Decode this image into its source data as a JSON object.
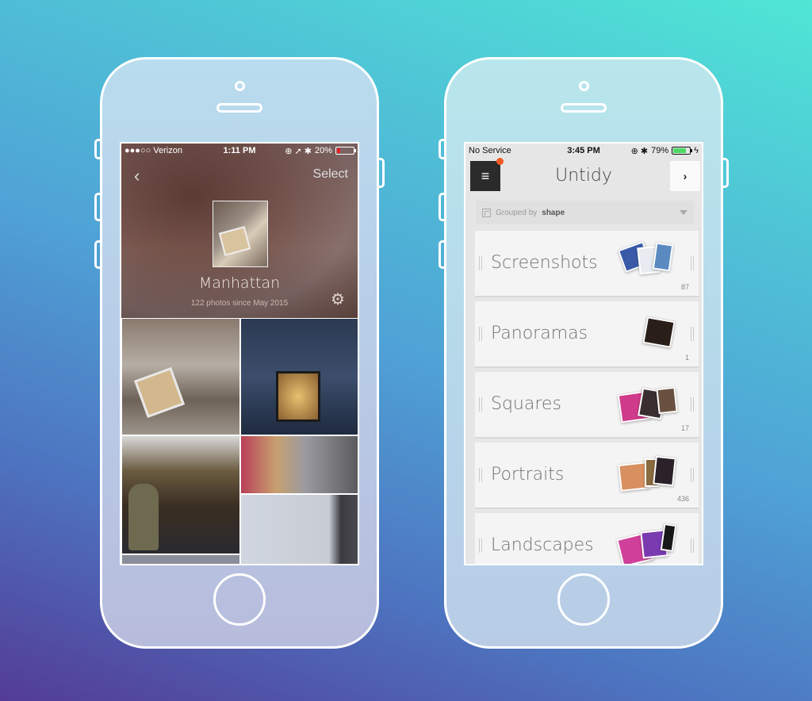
{
  "left_phone": {
    "status": {
      "carrier": "●●●○○ Verizon",
      "wifi_icon": "wifi-icon",
      "time": "1:11 PM",
      "icons": "⊕ ➚ ✱",
      "battery": "20%",
      "battery_level": 0.2,
      "battery_color": "#e8202a"
    },
    "nav": {
      "back": "‹",
      "select": "Select"
    },
    "album": {
      "title": "Manhattan",
      "subtitle": "122 photos since May 2015",
      "settings_icon": "⚙"
    },
    "photos": [
      {
        "description": "Hand holding wrapped package in street"
      },
      {
        "description": "Storefront window at night"
      },
      {
        "description": "Woman at market stall"
      },
      {
        "description": "Flatiron building with market"
      },
      {
        "description": "Overcast sky with building"
      },
      {
        "description": "Building facade strip"
      }
    ]
  },
  "right_phone": {
    "status": {
      "carrier": "No Service",
      "time": "3:45 PM",
      "icons": "⊕ ✱",
      "battery": "79%",
      "battery_level": 0.79,
      "battery_color": "#4cd964",
      "charging": "ϟ"
    },
    "nav": {
      "menu_icon": "≡",
      "title": "Untidy",
      "forward_icon": "›",
      "notification_color": "#f05a22"
    },
    "group": {
      "prefix": "Grouped by",
      "value": "shape"
    },
    "categories": [
      {
        "name": "Screenshots",
        "count": "87"
      },
      {
        "name": "Panoramas",
        "count": "1"
      },
      {
        "name": "Squares",
        "count": "17"
      },
      {
        "name": "Portraits",
        "count": "436"
      },
      {
        "name": "Landscapes",
        "count": ""
      }
    ]
  }
}
